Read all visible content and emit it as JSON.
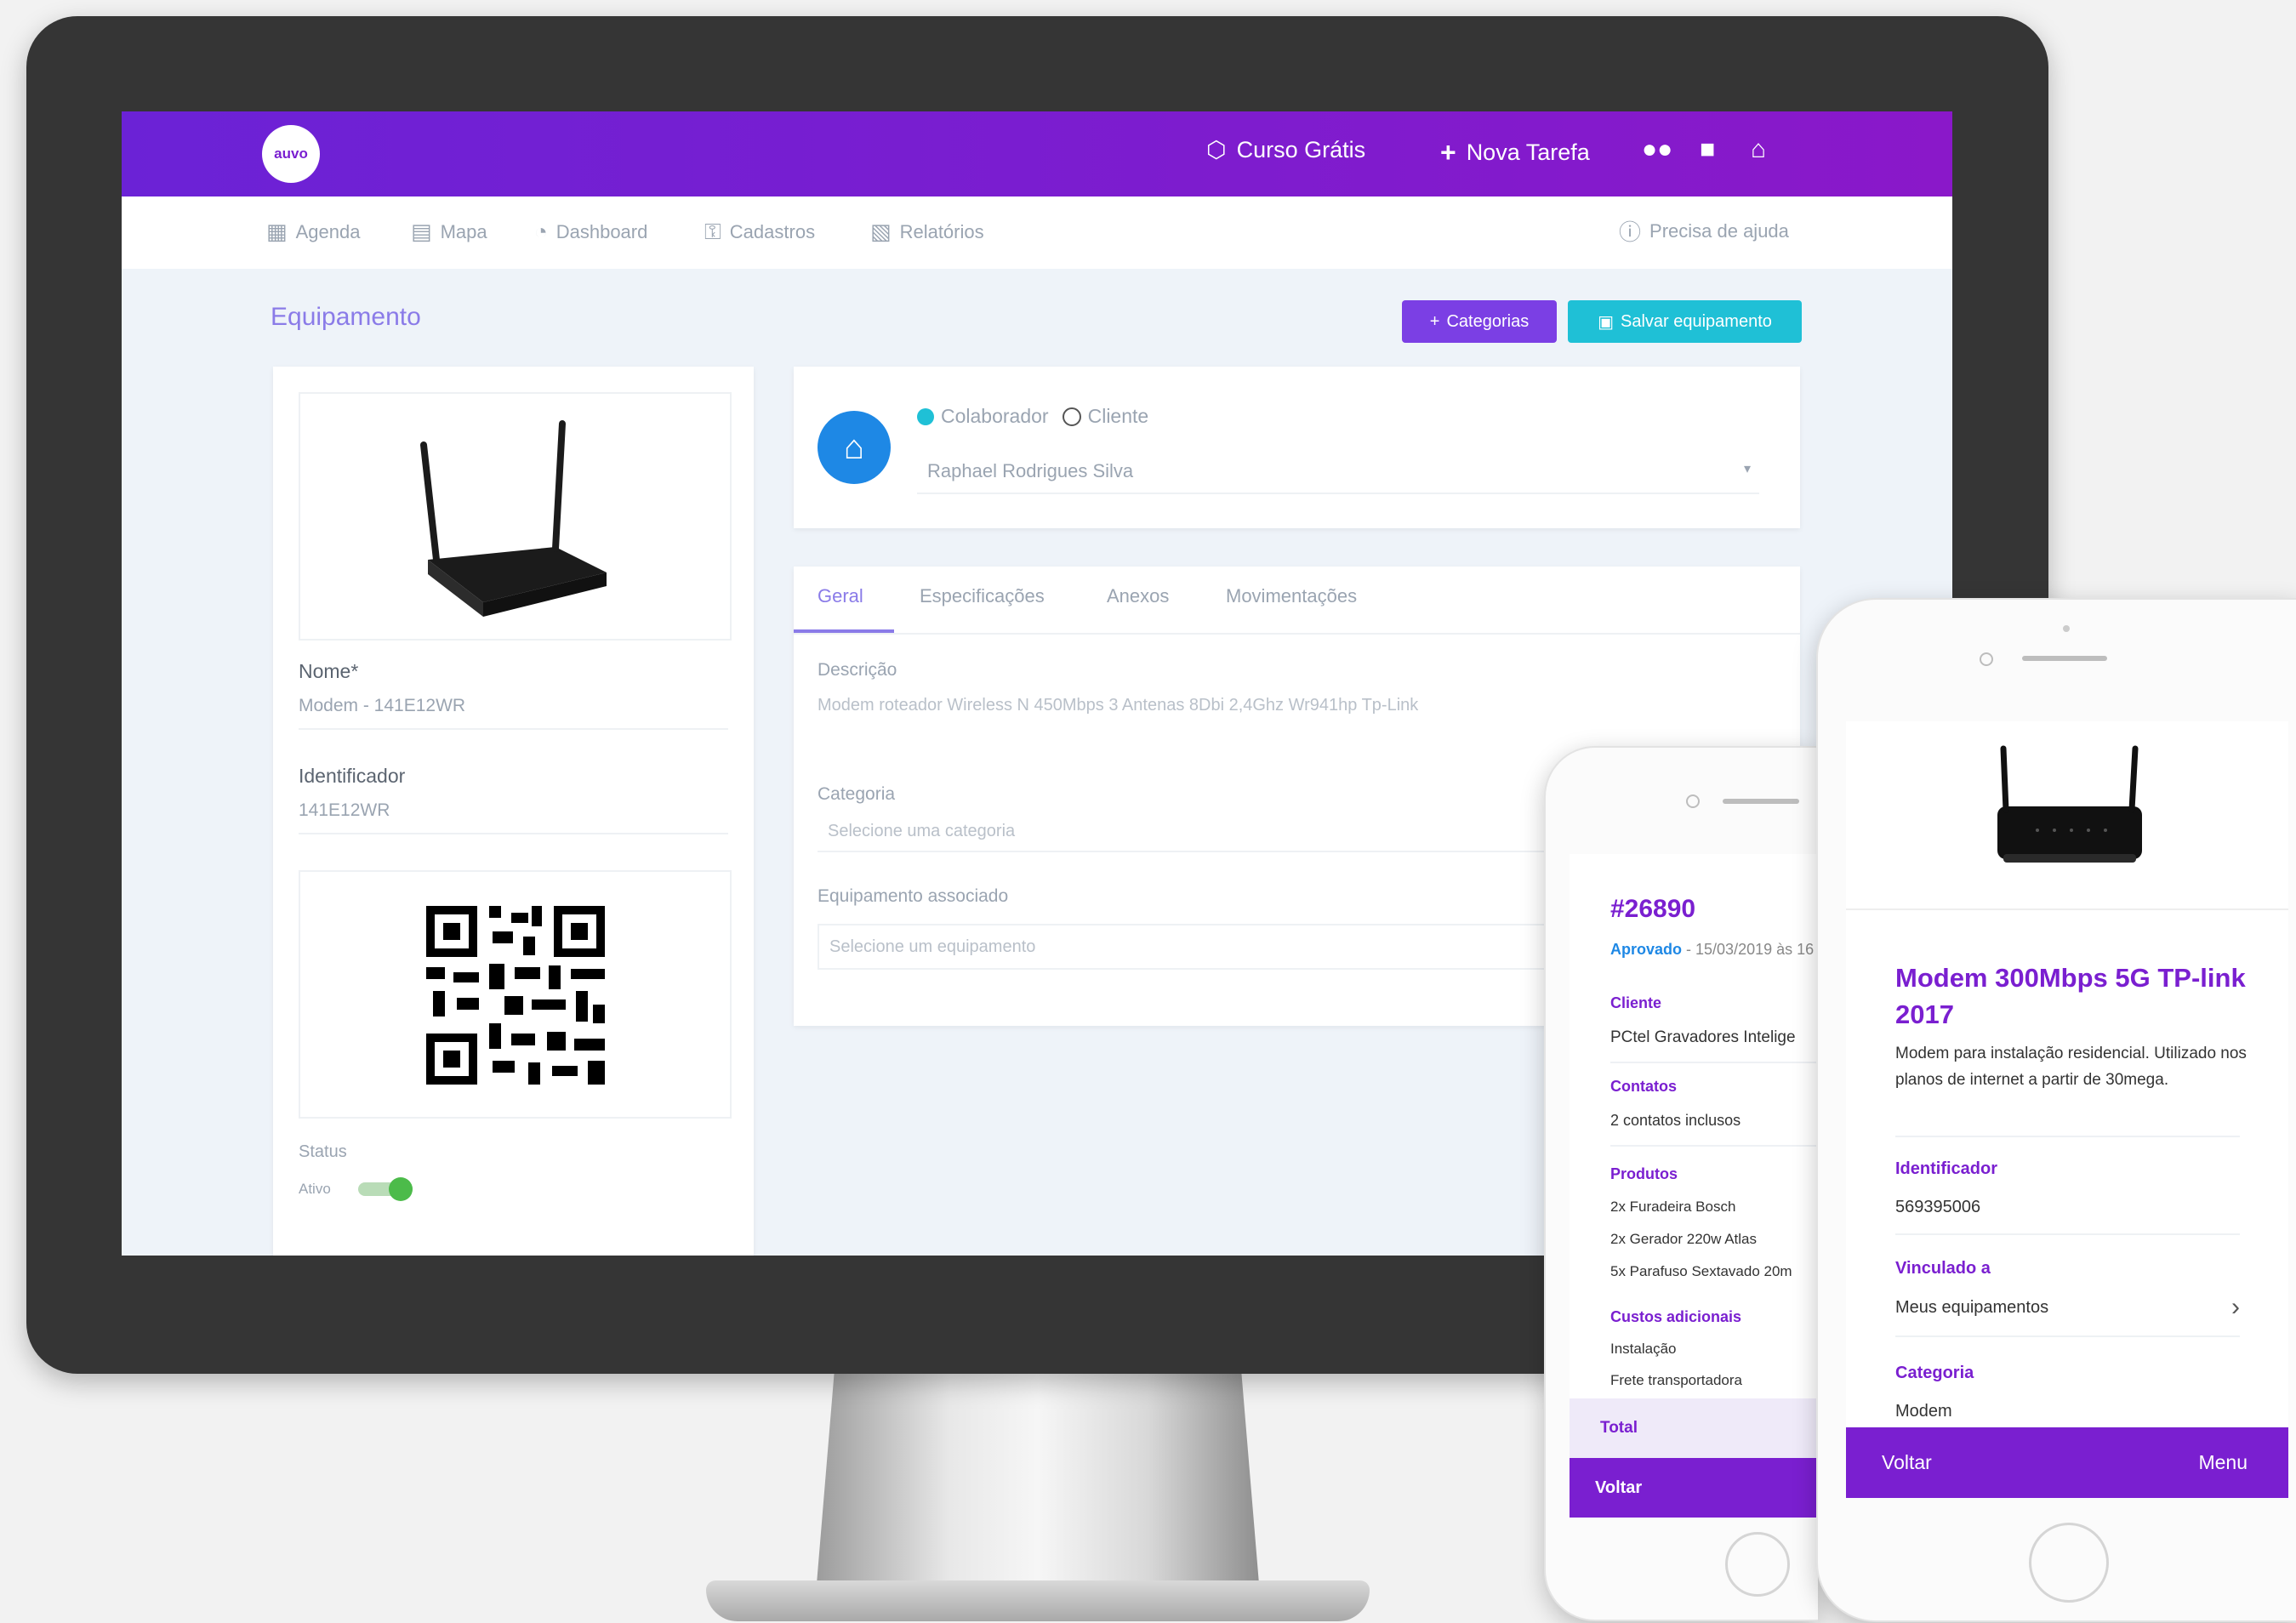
{
  "app": {
    "logo_text": "auvo"
  },
  "topbar": {
    "curso_label": "Curso Grátis",
    "nova_tarefa_label": "Nova Tarefa",
    "icons": [
      "share-icon",
      "plus-icon",
      "chat-bubbles-icon",
      "message-icon",
      "user-icon"
    ]
  },
  "nav": {
    "items": [
      {
        "label": "Agenda",
        "icon": "calendar-icon"
      },
      {
        "label": "Mapa",
        "icon": "map-icon"
      },
      {
        "label": "Dashboard",
        "icon": "dashboard-icon"
      },
      {
        "label": "Cadastros",
        "icon": "key-icon"
      },
      {
        "label": "Relatórios",
        "icon": "document-icon"
      }
    ],
    "help_label": "Precisa de ajuda"
  },
  "page": {
    "title": "Equipamento",
    "categorias_label": "Categorias",
    "salvar_label": "Salvar equipamento"
  },
  "left_card": {
    "nome_label": "Nome*",
    "nome_value": "Modem - 141E12WR",
    "identificador_label": "Identificador",
    "identificador_value": "141E12WR",
    "status_label": "Status",
    "status_value": "Ativo",
    "status_on": true
  },
  "owner_card": {
    "radio_colaborador": "Colaborador",
    "radio_cliente": "Cliente",
    "selected_person": "Raphael Rodrigues Silva"
  },
  "tabs": {
    "items": [
      "Geral",
      "Especificações",
      "Anexos",
      "Movimentações"
    ],
    "active": 0
  },
  "general": {
    "descricao_label": "Descrição",
    "descricao_value": "Modem roteador Wireless N 450Mbps 3 Antenas 8Dbi 2,4Ghz Wr941hp Tp-Link",
    "categoria_label": "Categoria",
    "categoria_placeholder": "Selecione uma categoria",
    "associado_label": "Equipamento associado",
    "associado_placeholder": "Selecione um equipamento"
  },
  "phone_small": {
    "order_id": "#26890",
    "status": "Aprovado",
    "date": "- 15/03/2019 às 16",
    "cliente_label": "Cliente",
    "cliente_value": "PCtel Gravadores Intelige",
    "contatos_label": "Contatos",
    "contatos_value": "2 contatos inclusos",
    "produtos_label": "Produtos",
    "produtos": [
      "2x Furadeira Bosch",
      "2x Gerador 220w Atlas",
      "5x Parafuso Sextavado 20m"
    ],
    "custos_label": "Custos adicionais",
    "custos": [
      "Instalação",
      "Frete transportadora"
    ],
    "total_label": "Total",
    "voltar_label": "Voltar"
  },
  "phone_large": {
    "title": "Modem 300Mbps 5G TP-link 2017",
    "description": "Modem para instalação residencial. Utilizado nos planos de internet a partir de 30mega.",
    "identificador_label": "Identificador",
    "identificador_value": "569395006",
    "vinculado_label": "Vinculado a",
    "vinculado_value": "Meus equipamentos",
    "categoria_label": "Categoria",
    "categoria_value": "Modem",
    "voltar_label": "Voltar",
    "menu_label": "Menu"
  },
  "colors": {
    "brand_purple": "#7a1fd0",
    "teal": "#1fc0d6",
    "blue": "#1e88e5",
    "toggle_green": "#4cbb4a"
  }
}
